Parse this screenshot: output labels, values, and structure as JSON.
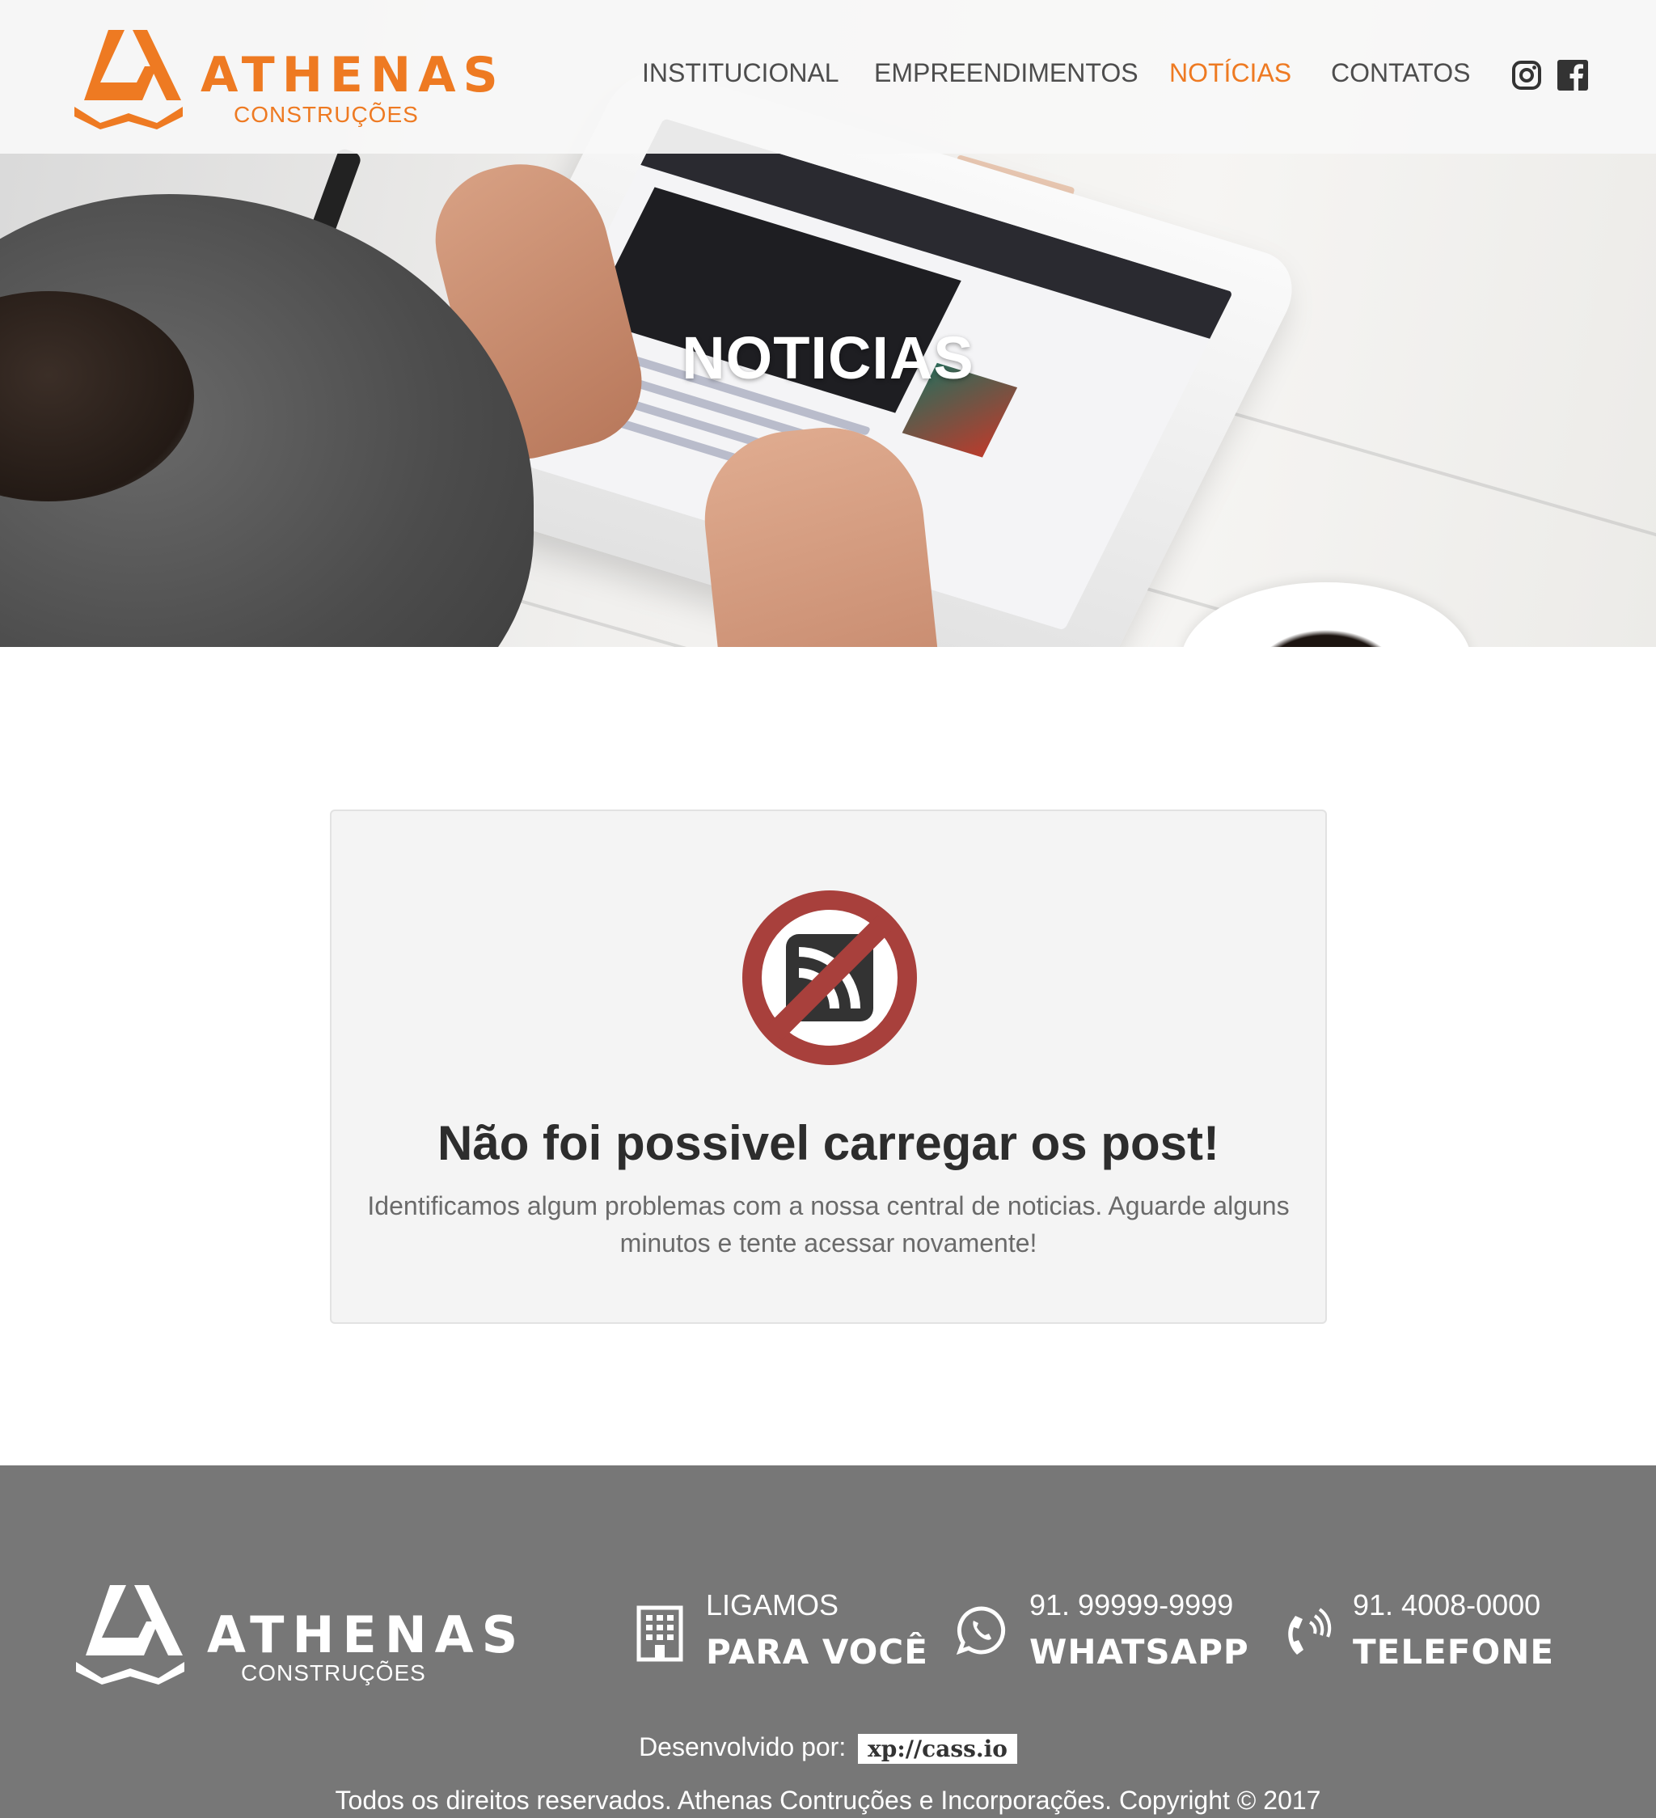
{
  "brand": {
    "name": "ATHENAS",
    "tagline": "CONSTRUÇÕES",
    "accent_color": "#ee7a22"
  },
  "nav": {
    "items": [
      {
        "label": "INSTITUCIONAL",
        "active": false
      },
      {
        "label": "EMPREENDIMENTOS",
        "active": false
      },
      {
        "label": "NOTÍCIAS",
        "active": true
      },
      {
        "label": "CONTATOS",
        "active": false
      }
    ],
    "social": [
      "instagram-icon",
      "facebook-icon"
    ]
  },
  "hero": {
    "title": "NOTICIAS"
  },
  "error": {
    "icon": "no-rss-icon",
    "title": "Não foi possivel carregar os post!",
    "message": "Identificamos algum problemas com a nossa central de noticias. Aguarde alguns minutos e tente acessar novamente!"
  },
  "footer": {
    "brand_name": "ATHENAS",
    "brand_tagline": "CONSTRUÇÕES",
    "contacts": [
      {
        "icon": "building-icon",
        "top": "LIGAMOS",
        "bottom": "PARA VOCÊ"
      },
      {
        "icon": "whatsapp-icon",
        "top": "91. 99999-9999",
        "bottom": "WHATSAPP"
      },
      {
        "icon": "phone-icon",
        "top": "91. 4008-0000",
        "bottom": "TELEFONE"
      }
    ],
    "developed_by_label": "Desenvolvido por:",
    "developer": "xp://cass.io",
    "copyright": "Todos os direitos reservados. Athenas Contruções e Incorporações. Copyright © 2017"
  }
}
